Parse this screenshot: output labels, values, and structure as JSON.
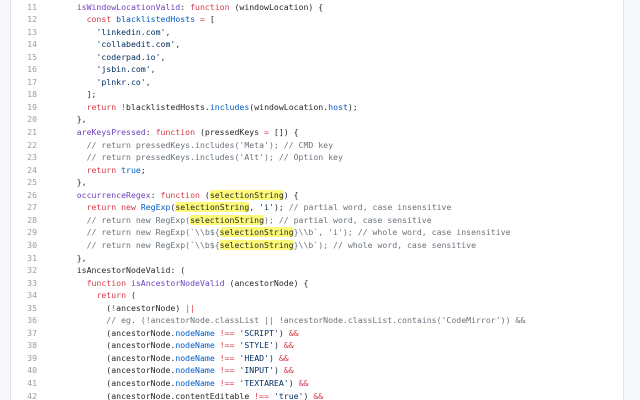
{
  "code_view": {
    "lines": [
      {
        "n": "11",
        "t": [
          [
            "    ",
            "pl"
          ],
          [
            "isWindowLocationValid",
            "fn"
          ],
          [
            ": ",
            "pl"
          ],
          [
            "function",
            "kw"
          ],
          [
            " (windowLocation) {",
            "pl"
          ]
        ]
      },
      {
        "n": "12",
        "t": [
          [
            "      ",
            "pl"
          ],
          [
            "const",
            "kw"
          ],
          [
            " ",
            "pl"
          ],
          [
            "blacklistedHosts",
            "cn"
          ],
          [
            " ",
            "pl"
          ],
          [
            "=",
            "kw"
          ],
          [
            " [",
            "pl"
          ]
        ]
      },
      {
        "n": "13",
        "t": [
          [
            "        ",
            "pl"
          ],
          [
            "'linkedin.com'",
            "str"
          ],
          [
            ",",
            "pl"
          ]
        ]
      },
      {
        "n": "14",
        "t": [
          [
            "        ",
            "pl"
          ],
          [
            "'collabedit.com'",
            "str"
          ],
          [
            ",",
            "pl"
          ]
        ]
      },
      {
        "n": "15",
        "t": [
          [
            "        ",
            "pl"
          ],
          [
            "'coderpad.io'",
            "str"
          ],
          [
            ",",
            "pl"
          ]
        ]
      },
      {
        "n": "16",
        "t": [
          [
            "        ",
            "pl"
          ],
          [
            "'jsbin.com'",
            "str"
          ],
          [
            ",",
            "pl"
          ]
        ]
      },
      {
        "n": "17",
        "t": [
          [
            "        ",
            "pl"
          ],
          [
            "'plnkr.co'",
            "str"
          ],
          [
            ",",
            "pl"
          ]
        ]
      },
      {
        "n": "18",
        "t": [
          [
            "      ];",
            "pl"
          ]
        ]
      },
      {
        "n": "19",
        "t": [
          [
            "      ",
            "pl"
          ],
          [
            "return",
            "kw"
          ],
          [
            " ",
            "pl"
          ],
          [
            "!",
            "kw"
          ],
          [
            "blacklistedHosts.",
            "pl"
          ],
          [
            "includes",
            "cn"
          ],
          [
            "(windowLocation.",
            "pl"
          ],
          [
            "host",
            "cn"
          ],
          [
            ");",
            "pl"
          ]
        ]
      },
      {
        "n": "20",
        "t": [
          [
            "    },",
            "pl"
          ]
        ]
      },
      {
        "n": "21",
        "t": [
          [
            "    ",
            "pl"
          ],
          [
            "areKeysPressed",
            "fn"
          ],
          [
            ": ",
            "pl"
          ],
          [
            "function",
            "kw"
          ],
          [
            " (pressedKeys ",
            "pl"
          ],
          [
            "=",
            "kw"
          ],
          [
            " []) {",
            "pl"
          ]
        ]
      },
      {
        "n": "22",
        "t": [
          [
            "      ",
            "pl"
          ],
          [
            "// return pressedKeys.includes('Meta'); // CMD key",
            "cm"
          ]
        ]
      },
      {
        "n": "23",
        "t": [
          [
            "      ",
            "pl"
          ],
          [
            "// return pressedKeys.includes('Alt'); // Option key",
            "cm"
          ]
        ]
      },
      {
        "n": "24",
        "t": [
          [
            "      ",
            "pl"
          ],
          [
            "return",
            "kw"
          ],
          [
            " ",
            "pl"
          ],
          [
            "true",
            "cn"
          ],
          [
            ";",
            "pl"
          ]
        ]
      },
      {
        "n": "25",
        "t": [
          [
            "    },",
            "pl"
          ]
        ]
      },
      {
        "n": "26",
        "t": [
          [
            "    ",
            "pl"
          ],
          [
            "occurrenceRegex",
            "fn"
          ],
          [
            ": ",
            "pl"
          ],
          [
            "function",
            "kw"
          ],
          [
            " (",
            "pl"
          ],
          [
            "selectionString",
            "hl"
          ],
          [
            ") {",
            "pl"
          ]
        ]
      },
      {
        "n": "27",
        "t": [
          [
            "      ",
            "pl"
          ],
          [
            "return",
            "kw"
          ],
          [
            " ",
            "pl"
          ],
          [
            "new",
            "kw"
          ],
          [
            " ",
            "pl"
          ],
          [
            "RegExp",
            "cn"
          ],
          [
            "(",
            "pl"
          ],
          [
            "selectionString",
            "hl"
          ],
          [
            ", ",
            "pl"
          ],
          [
            "'i'",
            "str"
          ],
          [
            "); ",
            "pl"
          ],
          [
            "// partial word, case insensitive",
            "cm"
          ]
        ]
      },
      {
        "n": "28",
        "t": [
          [
            "      ",
            "pl"
          ],
          [
            "// return new RegExp(",
            "cm"
          ],
          [
            "selectionString",
            "hl"
          ],
          [
            "); // partial word, case sensitive",
            "cm"
          ]
        ]
      },
      {
        "n": "29",
        "t": [
          [
            "      ",
            "pl"
          ],
          [
            "// return new RegExp(`\\\\b${",
            "cm"
          ],
          [
            "selectionString",
            "hl"
          ],
          [
            "}\\\\b`, 'i'); // whole word, case insensitive",
            "cm"
          ]
        ]
      },
      {
        "n": "30",
        "t": [
          [
            "      ",
            "pl"
          ],
          [
            "// return new RegExp(`\\\\b${",
            "cm"
          ],
          [
            "selectionString",
            "hl"
          ],
          [
            "}\\\\b`); // whole word, case sensitive",
            "cm"
          ]
        ]
      },
      {
        "n": "31",
        "t": [
          [
            "    },",
            "pl"
          ]
        ]
      },
      {
        "n": "32",
        "t": [
          [
            "    ",
            "pl"
          ],
          [
            "isAncestorNodeValid: (",
            "pl"
          ]
        ]
      },
      {
        "n": "33",
        "t": [
          [
            "      ",
            "pl"
          ],
          [
            "function",
            "kw"
          ],
          [
            " ",
            "pl"
          ],
          [
            "isAncestorNodeValid",
            "fn"
          ],
          [
            " (ancestorNode) {",
            "pl"
          ]
        ]
      },
      {
        "n": "34",
        "t": [
          [
            "        ",
            "pl"
          ],
          [
            "return",
            "kw"
          ],
          [
            " (",
            "pl"
          ]
        ]
      },
      {
        "n": "35",
        "t": [
          [
            "          (",
            "pl"
          ],
          [
            "!",
            "kw"
          ],
          [
            "ancestorNode) ",
            "pl"
          ],
          [
            "||",
            "kw"
          ]
        ]
      },
      {
        "n": "36",
        "t": [
          [
            "          ",
            "pl"
          ],
          [
            "// eg. (!ancestorNode.classList || !ancestorNode.classList.contains('CodeMirror')) &&",
            "cm"
          ]
        ]
      },
      {
        "n": "37",
        "t": [
          [
            "          (ancestorNode.",
            "pl"
          ],
          [
            "nodeName",
            "cn"
          ],
          [
            " ",
            "pl"
          ],
          [
            "!==",
            "kw"
          ],
          [
            " ",
            "pl"
          ],
          [
            "'SCRIPT'",
            "str"
          ],
          [
            ") ",
            "pl"
          ],
          [
            "&&",
            "kw"
          ]
        ]
      },
      {
        "n": "38",
        "t": [
          [
            "          (ancestorNode.",
            "pl"
          ],
          [
            "nodeName",
            "cn"
          ],
          [
            " ",
            "pl"
          ],
          [
            "!==",
            "kw"
          ],
          [
            " ",
            "pl"
          ],
          [
            "'STYLE'",
            "str"
          ],
          [
            ") ",
            "pl"
          ],
          [
            "&&",
            "kw"
          ]
        ]
      },
      {
        "n": "39",
        "t": [
          [
            "          (ancestorNode.",
            "pl"
          ],
          [
            "nodeName",
            "cn"
          ],
          [
            " ",
            "pl"
          ],
          [
            "!==",
            "kw"
          ],
          [
            " ",
            "pl"
          ],
          [
            "'HEAD'",
            "str"
          ],
          [
            ") ",
            "pl"
          ],
          [
            "&&",
            "kw"
          ]
        ]
      },
      {
        "n": "40",
        "t": [
          [
            "          (ancestorNode.",
            "pl"
          ],
          [
            "nodeName",
            "cn"
          ],
          [
            " ",
            "pl"
          ],
          [
            "!==",
            "kw"
          ],
          [
            " ",
            "pl"
          ],
          [
            "'INPUT'",
            "str"
          ],
          [
            ") ",
            "pl"
          ],
          [
            "&&",
            "kw"
          ]
        ]
      },
      {
        "n": "41",
        "t": [
          [
            "          (ancestorNode.",
            "pl"
          ],
          [
            "nodeName",
            "cn"
          ],
          [
            " ",
            "pl"
          ],
          [
            "!==",
            "kw"
          ],
          [
            " ",
            "pl"
          ],
          [
            "'TEXTAREA'",
            "str"
          ],
          [
            ") ",
            "pl"
          ],
          [
            "&&",
            "kw"
          ]
        ]
      },
      {
        "n": "42",
        "t": [
          [
            "          (ancestorNode.contentEditable ",
            "pl"
          ],
          [
            "!==",
            "kw"
          ],
          [
            " ",
            "pl"
          ],
          [
            "'true'",
            "str"
          ],
          [
            ") ",
            "pl"
          ],
          [
            "&&",
            "kw"
          ]
        ]
      }
    ]
  },
  "colors": {
    "keyword": "#d73a49",
    "function": "#6f42c1",
    "string": "#032f62",
    "comment": "#6a737d",
    "constant": "#005cc5",
    "text": "#24292e",
    "line_number": "#959da5",
    "highlight": "#fffb7a"
  }
}
